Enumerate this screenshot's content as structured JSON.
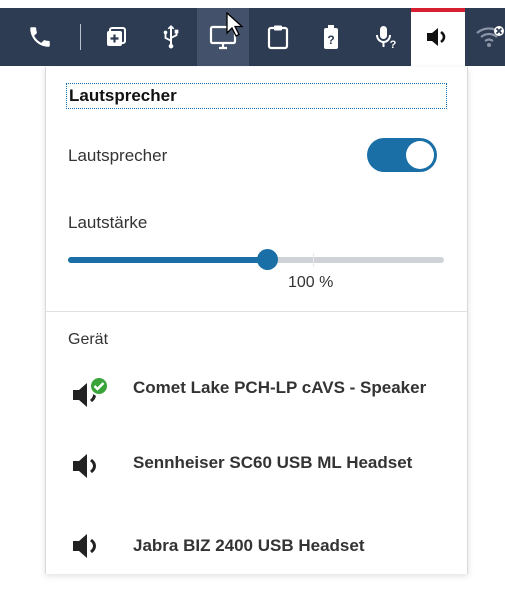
{
  "toolbar": {
    "items": [
      {
        "icon": "phone-icon"
      },
      {
        "icon": "add-window-icon"
      },
      {
        "icon": "usb-icon"
      },
      {
        "icon": "monitor-icon"
      },
      {
        "icon": "clipboard-icon"
      },
      {
        "icon": "battery-icon"
      },
      {
        "icon": "microphone-icon"
      },
      {
        "icon": "speaker-icon",
        "active": true
      },
      {
        "icon": "wifi-off-icon"
      }
    ]
  },
  "panel": {
    "title": "Lautsprecher",
    "speaker_toggle_label": "Lautsprecher",
    "speaker_toggle_on": true,
    "volume_label": "Lautstärke",
    "volume_value_text": "100 %",
    "volume_fraction": 0.53,
    "device_header": "Gerät",
    "devices": [
      {
        "name": "Comet Lake PCH-LP cAVS - Speaker",
        "selected": true
      },
      {
        "name": "Sennheiser SC60 USB ML Headset",
        "selected": false
      },
      {
        "name": "Jabra BIZ 2400 USB Headset",
        "selected": false
      }
    ]
  },
  "colors": {
    "toolbar_bg": "#2d3b53",
    "accent": "#1a6fa6",
    "active_marker": "#d61f31",
    "check_green": "#3aa33a"
  }
}
